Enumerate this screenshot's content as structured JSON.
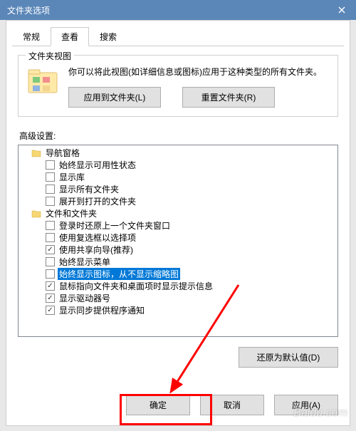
{
  "title": "文件夹选项",
  "tabs": {
    "general": "常规",
    "view": "查看",
    "search": "搜索"
  },
  "folderView": {
    "legend": "文件夹视图",
    "desc": "你可以将此视图(如详细信息或图标)应用于这种类型的所有文件夹。",
    "applyBtn": "应用到文件夹(L)",
    "resetBtn": "重置文件夹(R)"
  },
  "advanced": {
    "label": "高级设置:",
    "items": [
      {
        "type": "folder",
        "indent": 1,
        "label": "导航窗格"
      },
      {
        "type": "check",
        "indent": 2,
        "checked": false,
        "label": "始终显示可用性状态"
      },
      {
        "type": "check",
        "indent": 2,
        "checked": false,
        "label": "显示库"
      },
      {
        "type": "check",
        "indent": 2,
        "checked": false,
        "label": "显示所有文件夹"
      },
      {
        "type": "check",
        "indent": 2,
        "checked": false,
        "label": "展开到打开的文件夹"
      },
      {
        "type": "folder",
        "indent": 1,
        "label": "文件和文件夹"
      },
      {
        "type": "check",
        "indent": 2,
        "checked": false,
        "label": "登录时还原上一个文件夹窗口"
      },
      {
        "type": "check",
        "indent": 2,
        "checked": false,
        "label": "使用复选框以选择项"
      },
      {
        "type": "check",
        "indent": 2,
        "checked": true,
        "label": "使用共享向导(推荐)"
      },
      {
        "type": "check",
        "indent": 2,
        "checked": false,
        "label": "始终显示菜单"
      },
      {
        "type": "check",
        "indent": 2,
        "checked": false,
        "selected": true,
        "label": "始终显示图标，从不显示缩略图"
      },
      {
        "type": "check",
        "indent": 2,
        "checked": true,
        "label": "鼠标指向文件夹和桌面项时显示提示信息"
      },
      {
        "type": "check",
        "indent": 2,
        "checked": true,
        "label": "显示驱动器号"
      },
      {
        "type": "check",
        "indent": 2,
        "checked": true,
        "label": "显示同步提供程序通知"
      }
    ]
  },
  "restoreBtn": "还原为默认值(D)",
  "buttons": {
    "ok": "确定",
    "cancel": "取消",
    "apply": "应用(A)"
  },
  "watermark": "Baidu.com"
}
